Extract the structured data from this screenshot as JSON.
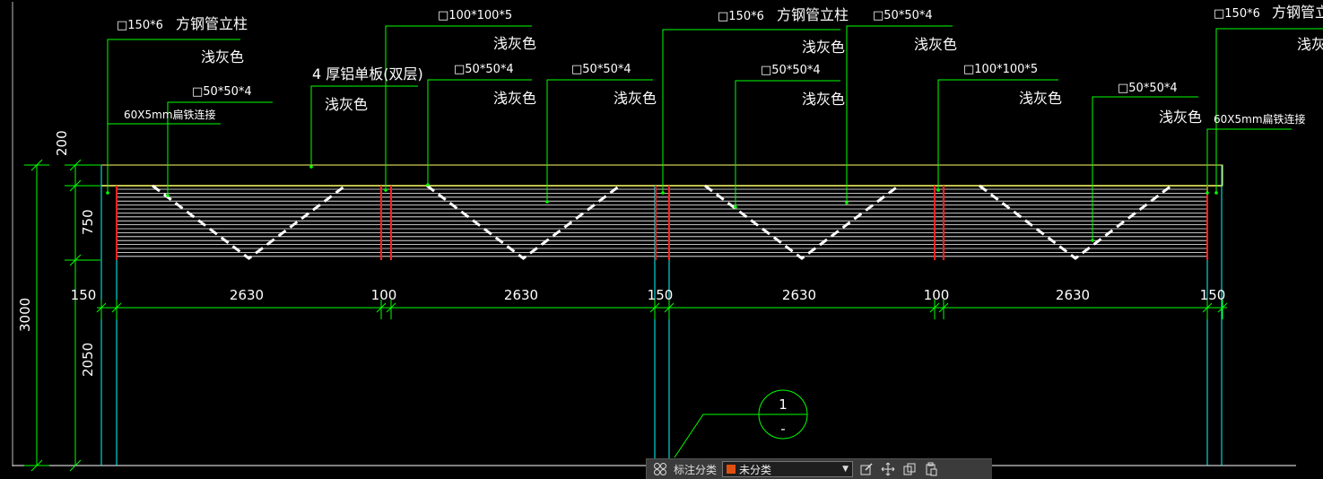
{
  "colors": {
    "background": "#000000",
    "leader_line": "#00ff00",
    "dimension_line": "#00ff00",
    "top_cap_outline": "#ffff66",
    "column_outline": "#00ffff",
    "column_divider": "#ff2020",
    "slat": "#ffffff",
    "category_swatch": "#e05010"
  },
  "labels": {
    "col_left_spec": "□150*6",
    "col_left_name": "方钢管立柱",
    "col_left_color": "浅灰色",
    "brace_left_spec": "□50*50*4",
    "connector_left": "60X5mm扁铁连接",
    "panel_spec": "4 厚铝单板(双层)",
    "panel_color": "浅灰色",
    "div1_spec": "□100*100*5",
    "div1_color": "浅灰色",
    "slat_a_spec": "□50*50*4",
    "slat_a_color": "浅灰色",
    "slat_b_spec": "□50*50*4",
    "slat_b_color": "浅灰色",
    "col_mid_spec": "□150*6",
    "col_mid_name": "方钢管立柱",
    "col_mid_color": "浅灰色",
    "slat_c_spec": "□50*50*4",
    "slat_c_color": "浅灰色",
    "slat_d_spec": "□50*50*4",
    "slat_d_color": "浅灰色",
    "div3_spec": "□100*100*5",
    "div3_color": "浅灰色",
    "slat_e_spec": "□50*50*4",
    "slat_e_color": "浅灰色",
    "col_right_spec": "□150*6",
    "col_right_name": "方钢管立柱",
    "col_right_color": "浅灰色",
    "connector_right": "60X5mm扁铁连接"
  },
  "dimensions": {
    "top_band": "200",
    "panel_height": "750",
    "clear_height": "2050",
    "total_height": "3000",
    "h_segments": [
      "150",
      "2630",
      "100",
      "2630",
      "150",
      "2630",
      "100",
      "2630",
      "150"
    ]
  },
  "detail_marker": {
    "number": "1",
    "sheet": "-"
  },
  "toolbar": {
    "annotation_label": "标注分类",
    "category_value": "未分类",
    "icons": [
      "classify-icon",
      "edit-icon",
      "move-icon",
      "copy-icon",
      "paste-icon"
    ]
  }
}
